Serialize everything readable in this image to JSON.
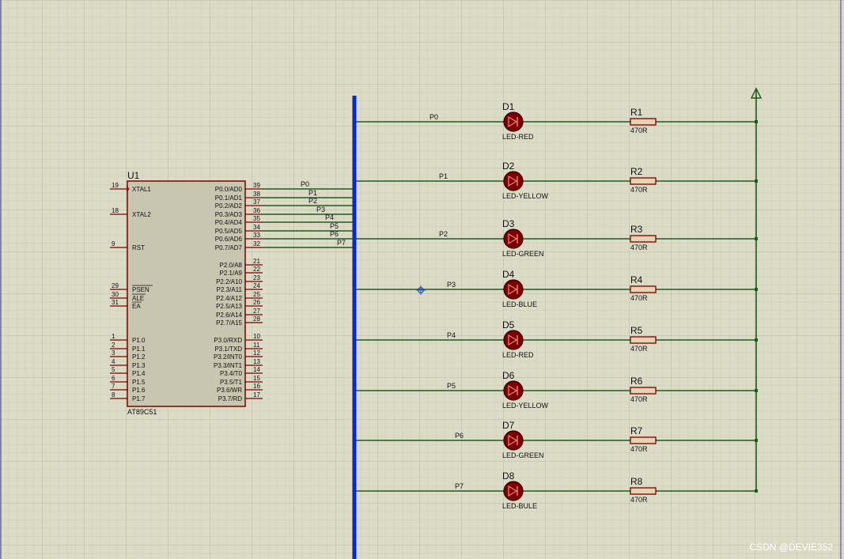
{
  "colors": {
    "background": "#dcdcc6",
    "grid_minor": "#c9c9b4",
    "grid_major": "#b9b9a4",
    "wire": "#1f5a1f",
    "bus": "#0a28c8",
    "component": "#7a0000",
    "ic_fill": "#c9c6b0",
    "led_fill": "#7a0000",
    "resistor_fill": "#e6d3b3",
    "watermark": "#ffffff"
  },
  "mcu": {
    "ref": "U1",
    "part": "AT89C51",
    "left_pins": [
      {
        "num": "19",
        "name": "XTAL1"
      },
      {
        "num": "18",
        "name": "XTAL2"
      },
      {
        "num": "9",
        "name": "RST"
      },
      {
        "num": "29",
        "name": "PSEN"
      },
      {
        "num": "30",
        "name": "ALE"
      },
      {
        "num": "31",
        "name": "EA"
      },
      {
        "num": "1",
        "name": "P1.0"
      },
      {
        "num": "2",
        "name": "P1.1"
      },
      {
        "num": "3",
        "name": "P1.2"
      },
      {
        "num": "4",
        "name": "P1.3"
      },
      {
        "num": "5",
        "name": "P1.4"
      },
      {
        "num": "6",
        "name": "P1.5"
      },
      {
        "num": "7",
        "name": "P1.6"
      },
      {
        "num": "8",
        "name": "P1.7"
      }
    ],
    "right_pins": [
      {
        "num": "39",
        "name": "P0.0/AD0"
      },
      {
        "num": "38",
        "name": "P0.1/AD1"
      },
      {
        "num": "37",
        "name": "P0.2/AD2"
      },
      {
        "num": "36",
        "name": "P0.3/AD3"
      },
      {
        "num": "35",
        "name": "P0.4/AD4"
      },
      {
        "num": "34",
        "name": "P0.5/AD5"
      },
      {
        "num": "33",
        "name": "P0.6/AD6"
      },
      {
        "num": "32",
        "name": "P0.7/AD7"
      },
      {
        "num": "21",
        "name": "P2.0/A8"
      },
      {
        "num": "22",
        "name": "P2.1/A9"
      },
      {
        "num": "23",
        "name": "P2.2/A10"
      },
      {
        "num": "24",
        "name": "P2.3/A11"
      },
      {
        "num": "25",
        "name": "P2.4/A12"
      },
      {
        "num": "26",
        "name": "P2.5/A13"
      },
      {
        "num": "27",
        "name": "P2.6/A14"
      },
      {
        "num": "28",
        "name": "P2.7/A15"
      },
      {
        "num": "10",
        "name": "P3.0/RXD"
      },
      {
        "num": "11",
        "name": "P3.1/TXD"
      },
      {
        "num": "12",
        "name": "P3.2/INT0"
      },
      {
        "num": "13",
        "name": "P3.3/INT1"
      },
      {
        "num": "14",
        "name": "P3.4/T0"
      },
      {
        "num": "15",
        "name": "P3.5/T1"
      },
      {
        "num": "16",
        "name": "P3.6/WR"
      },
      {
        "num": "17",
        "name": "P3.7/RD"
      }
    ]
  },
  "bus_labels": [
    "P0",
    "P1",
    "P2",
    "P3",
    "P4",
    "P5",
    "P6",
    "P7"
  ],
  "channels": [
    {
      "net": "P0",
      "led_ref": "D1",
      "led_type": "LED-RED",
      "res_ref": "R1",
      "res_value": "470R"
    },
    {
      "net": "P1",
      "led_ref": "D2",
      "led_type": "LED-YELLOW",
      "res_ref": "R2",
      "res_value": "470R"
    },
    {
      "net": "P2",
      "led_ref": "D3",
      "led_type": "LED-GREEN",
      "res_ref": "R3",
      "res_value": "470R"
    },
    {
      "net": "P3",
      "led_ref": "D4",
      "led_type": "LED-BLUE",
      "res_ref": "R4",
      "res_value": "470R"
    },
    {
      "net": "P4",
      "led_ref": "D5",
      "led_type": "LED-RED",
      "res_ref": "R5",
      "res_value": "470R"
    },
    {
      "net": "P5",
      "led_ref": "D6",
      "led_type": "LED-YELLOW",
      "res_ref": "R6",
      "res_value": "470R"
    },
    {
      "net": "P6",
      "led_ref": "D7",
      "led_type": "LED-GREEN",
      "res_ref": "R7",
      "res_value": "470R"
    },
    {
      "net": "P7",
      "led_ref": "D8",
      "led_type": "LED-BULE",
      "res_ref": "R8",
      "res_value": "470R"
    }
  ],
  "power_terminal": "power-arrow-icon",
  "watermark": "CSDN @DEVIE352"
}
